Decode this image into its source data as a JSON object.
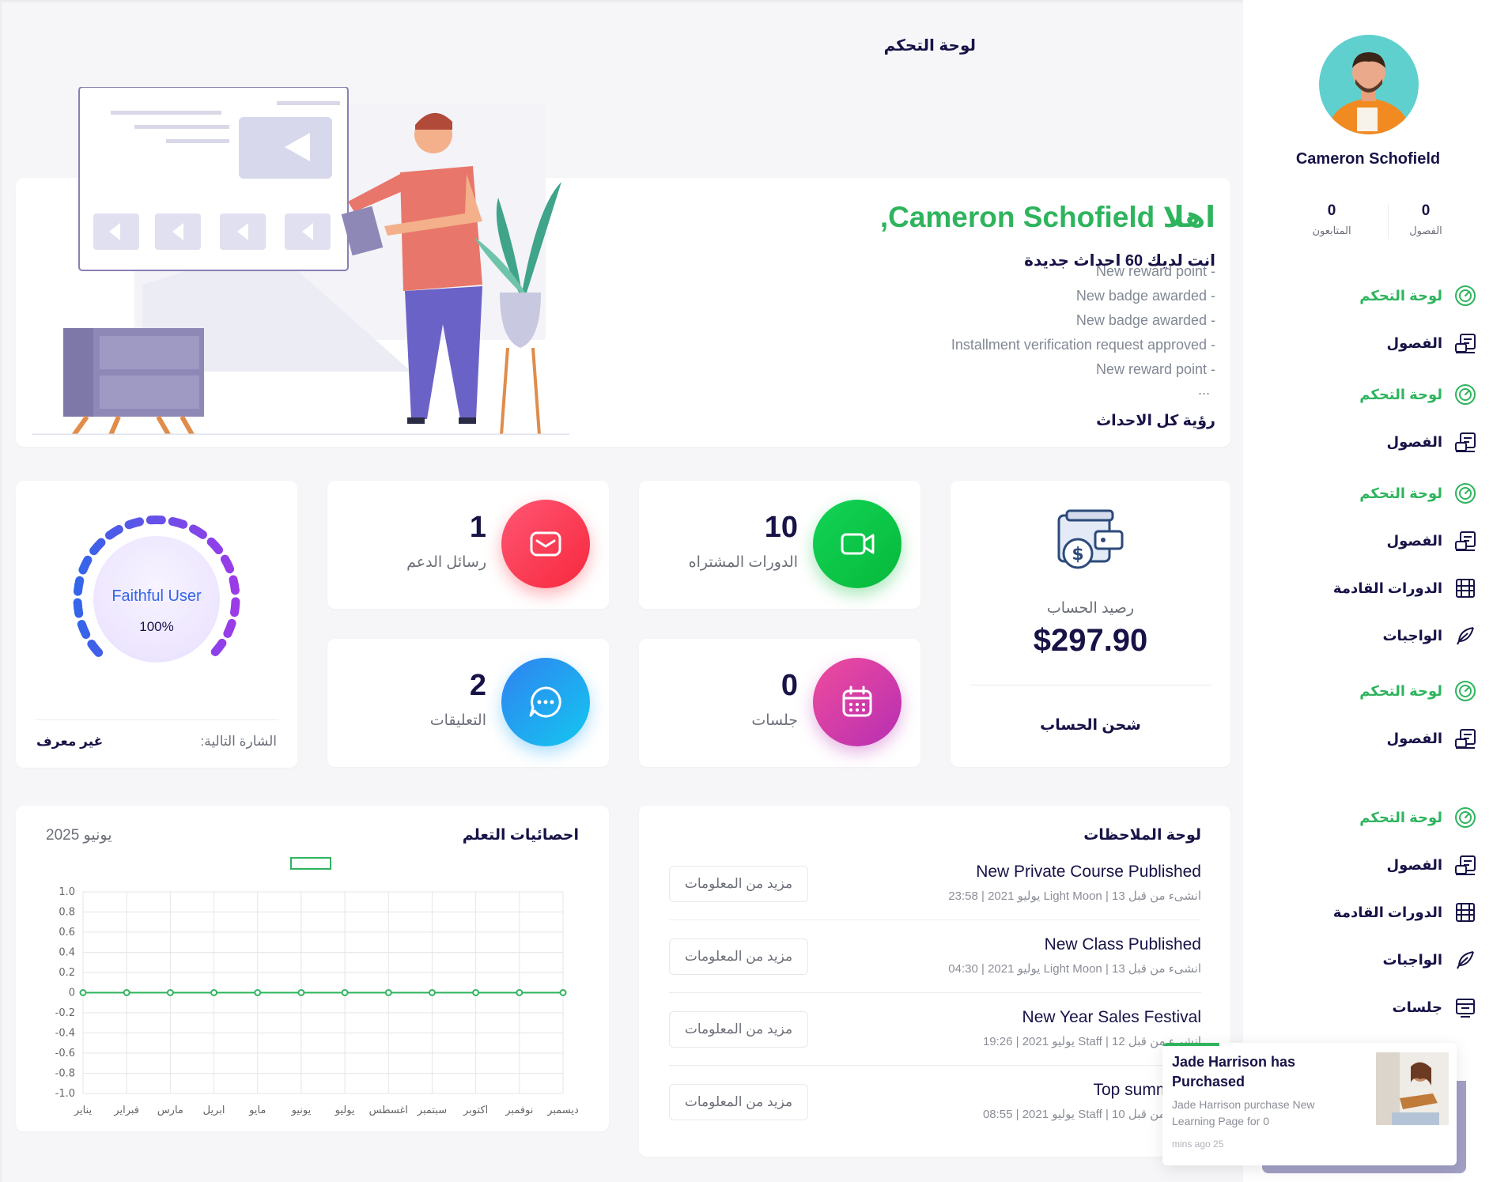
{
  "page_title": "لوحة التحكم",
  "hero": {
    "greeting": "اهلا Cameron Schofield,",
    "events_count": "انت لديك 60 احداث جديدة",
    "notifications": [
      "New reward point -",
      "New badge awarded -",
      "New badge awarded -",
      "Installment verification request approved -",
      "New reward point -"
    ],
    "ellipsis": "...",
    "view_all": "رؤية كل الاحداث"
  },
  "stats": {
    "support": {
      "value": "1",
      "label": "رسائل الدعم"
    },
    "courses": {
      "value": "10",
      "label": "الدورات المشتراه"
    },
    "comments": {
      "value": "2",
      "label": "التعليقات"
    },
    "sessions": {
      "value": "0",
      "label": "جلسات"
    }
  },
  "balance": {
    "label": "رصيد الحساب",
    "amount": "$297.90",
    "charge": "شحن الحساب"
  },
  "badge": {
    "name": "Faithful User",
    "percent": "100%",
    "progress": 1.0,
    "next_label": "الشارة التالية:",
    "next_value": "غير معرف"
  },
  "notes": {
    "title": "لوحة الملاحظات",
    "items": [
      {
        "title": "New Private Course Published",
        "meta": "انشىء من قبل Light Moon | 13 يوليو 2021 | 23:58",
        "button": "مزيد من المعلومات"
      },
      {
        "title": "New Class Published",
        "meta": "انشىء من قبل Light Moon | 13 يوليو 2021 | 04:30",
        "button": "مزيد من المعلومات"
      },
      {
        "title": "New Year Sales Festival",
        "meta": "انشىء من قبل Staff | 12 يوليو 2021 | 19:26",
        "button": "مزيد من المعلومات"
      },
      {
        "title": "Top summer cl",
        "meta": "انشىء من قبل Staff | 10 يوليو 2021 | 08:55",
        "button": "مزيد من المعلومات"
      }
    ]
  },
  "learning": {
    "title": "احصائيات التعلم",
    "date": "يونيو 2025"
  },
  "chart_data": {
    "type": "line",
    "categories": [
      "يناير",
      "فبراير",
      "مارس",
      "ابريل",
      "مايو",
      "يونيو",
      "يوليو",
      "اغسطس",
      "سبتمبر",
      "اكتوبر",
      "نوفمبر",
      "ديسمبر"
    ],
    "series": [
      {
        "values": [
          0,
          0,
          0,
          0,
          0,
          0,
          0,
          0,
          0,
          0,
          0,
          0
        ],
        "color": "#2fb45e"
      }
    ],
    "y_tick_labels": [
      "1.0",
      "0.8",
      "0.6",
      "0.4",
      "0.2",
      "0",
      "-0.2",
      "-0.4",
      "-0.6",
      "-0.8",
      "-1.0"
    ],
    "ylim": [
      -1,
      1
    ],
    "grid": true
  },
  "profile": {
    "name": "Cameron Schofield",
    "classes_label": "الفصول",
    "classes_value": "0",
    "followers_label": "المتابعون",
    "followers_value": "0"
  },
  "menu": [
    {
      "label": "لوحة التحكم",
      "icon": "dashboard-icon",
      "active": true
    },
    {
      "label": "الفصول",
      "icon": "classes-icon",
      "active": false
    },
    {
      "label": "لوحة التحكم",
      "icon": "dashboard-icon",
      "active": true
    },
    {
      "label": "الفصول",
      "icon": "classes-icon",
      "active": false
    },
    {
      "label": "لوحة التحكم",
      "icon": "dashboard-icon",
      "active": true
    },
    {
      "label": "الفصول",
      "icon": "classes-icon",
      "active": false
    },
    {
      "label": "الدورات القادمة",
      "icon": "film-icon",
      "active": false
    },
    {
      "label": "الواجبات",
      "icon": "feather-icon",
      "active": false
    },
    {
      "label": "لوحة التحكم",
      "icon": "dashboard-icon",
      "active": true
    },
    {
      "label": "الفصول",
      "icon": "classes-icon",
      "active": false
    },
    {
      "label": "لوحة التحكم",
      "icon": "dashboard-icon",
      "active": true
    },
    {
      "label": "الفصول",
      "icon": "classes-icon",
      "active": false
    },
    {
      "label": "الدورات القادمة",
      "icon": "film-icon",
      "active": false
    },
    {
      "label": "الواجبات",
      "icon": "feather-icon",
      "active": false
    },
    {
      "label": "جلسات",
      "icon": "sessions-icon",
      "active": false
    }
  ],
  "toast": {
    "title": "Jade Harrison has Purchased",
    "body": "Jade Harrison purchase New Learning Page for 0",
    "time": "mins ago 25"
  },
  "colors": {
    "accent": "#2fb45e",
    "dark": "#171347",
    "muted": "#818894"
  }
}
